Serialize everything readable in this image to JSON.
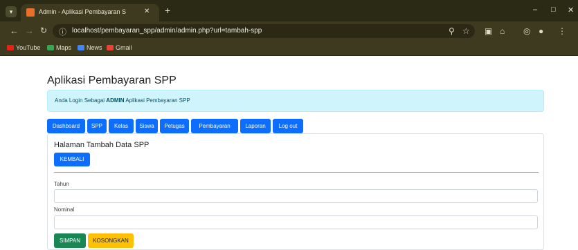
{
  "browser": {
    "tab_title": "Admin - Aplikasi Pembayaran S",
    "tab_close": "✕",
    "new_tab": "+",
    "url": "localhost/pembayaran_spp/admin/admin.php?url=tambah-spp",
    "bookmarks": [
      "YouTube",
      "Maps",
      "News",
      "Gmail"
    ],
    "window_controls": [
      "–",
      "□",
      "✕"
    ]
  },
  "page": {
    "title": "Aplikasi Pembayaran SPP",
    "alert": {
      "prefix": "Anda Login Sebagai",
      "role": "ADMIN",
      "suffix": "Aplikasi Pembayaran SPP",
      "color": "#cff4fc"
    },
    "nav": [
      "Dashboard",
      "SPP",
      "Kelas",
      "Siswa",
      "Petugas",
      "Pembayaran",
      "Laporan",
      "Log out"
    ],
    "card": {
      "title": "Halaman Tambah Data SPP",
      "back_label": "KEMBALI",
      "fields": [
        {
          "label": "Tahun",
          "value": ""
        },
        {
          "label": "Nominal",
          "value": ""
        }
      ],
      "save_label": "SIMPAN",
      "reset_label": "KOSONGKAN"
    },
    "colors": {
      "primary": "#0d6efd",
      "success": "#198754",
      "warning": "#ffc107"
    }
  }
}
